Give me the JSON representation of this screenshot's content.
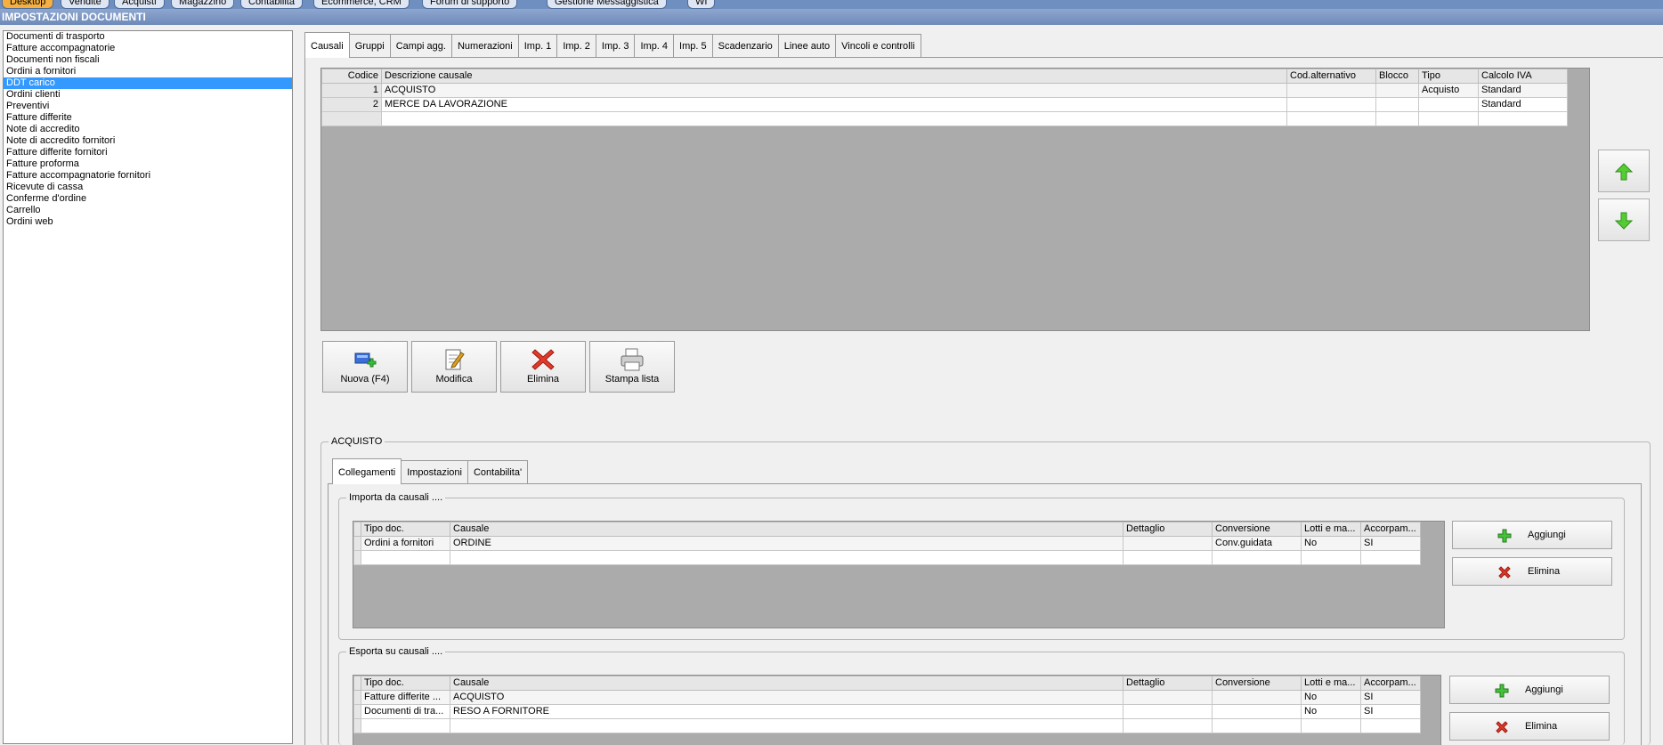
{
  "window": {
    "menu_tabs": [
      "Desktop",
      "Vendite",
      "Acquisti",
      "Magazzino",
      "Contabilita",
      "Ecommerce, CRM",
      "Forum di supporto",
      "Gestione Messaggistica",
      "WI"
    ],
    "title": "IMPOSTAZIONI DOCUMENTI"
  },
  "doc_list": {
    "items": [
      "Documenti di trasporto",
      "Fatture accompagnatorie",
      "Documenti non fiscali",
      "Ordini a fornitori",
      "DDT carico",
      "Ordini clienti",
      "Preventivi",
      "Fatture differite",
      "Note di accredito",
      "Note di accredito fornitori",
      "Fatture differite fornitori",
      "Fatture proforma",
      "Fatture accompagnatorie fornitori",
      "Ricevute di cassa",
      "Conferme d'ordine",
      "Carrello",
      "Ordini web"
    ],
    "selected_index": 4
  },
  "main_tabs": {
    "items": [
      "Causali",
      "Gruppi",
      "Campi agg.",
      "Numerazioni",
      "Imp. 1",
      "Imp. 2",
      "Imp. 3",
      "Imp. 4",
      "Imp. 5",
      "Scadenzario",
      "Linee auto",
      "Vincoli e controlli"
    ],
    "active_index": 0
  },
  "causali_grid": {
    "headers": [
      "Codice",
      "Descrizione causale",
      "Cod.alternativo",
      "Blocco",
      "Tipo",
      "Calcolo IVA"
    ],
    "rows": [
      [
        "1",
        "ACQUISTO",
        "",
        "",
        "Acquisto",
        "Standard"
      ],
      [
        "2",
        "MERCE DA LAVORAZIONE",
        "",
        "",
        "",
        "Standard"
      ]
    ]
  },
  "actions": {
    "nuova": "Nuova (F4)",
    "modifica": "Modifica",
    "elimina": "Elimina",
    "stampa": "Stampa lista"
  },
  "detail": {
    "group_title": "ACQUISTO",
    "tabs": [
      "Collegamenti",
      "Impostazioni",
      "Contabilita'"
    ],
    "active_index": 0,
    "importa": {
      "legend": "Importa da causali ....",
      "headers": [
        "Tipo doc.",
        "Causale",
        "Dettaglio",
        "Conversione",
        "Lotti e ma...",
        "Accorpam..."
      ],
      "rows": [
        [
          "Ordini a fornitori",
          "ORDINE",
          "",
          "Conv.guidata",
          "No",
          "SI"
        ]
      ],
      "add_label": "Aggiungi",
      "remove_label": "Elimina"
    },
    "esporta": {
      "legend": "Esporta su causali ....",
      "headers": [
        "Tipo doc.",
        "Causale",
        "Dettaglio",
        "Conversione",
        "Lotti e ma...",
        "Accorpam..."
      ],
      "rows": [
        [
          "Fatture differite ...",
          "ACQUISTO",
          "",
          "",
          "No",
          "SI"
        ],
        [
          "Documenti di tra...",
          "RESO A FORNITORE",
          "",
          "",
          "No",
          "SI"
        ]
      ],
      "add_label": "Aggiungi",
      "remove_label": "Elimina"
    }
  },
  "colors": {
    "titlebar": "#7b96c4",
    "selection": "#3399ff",
    "grid_background": "#ababab"
  }
}
